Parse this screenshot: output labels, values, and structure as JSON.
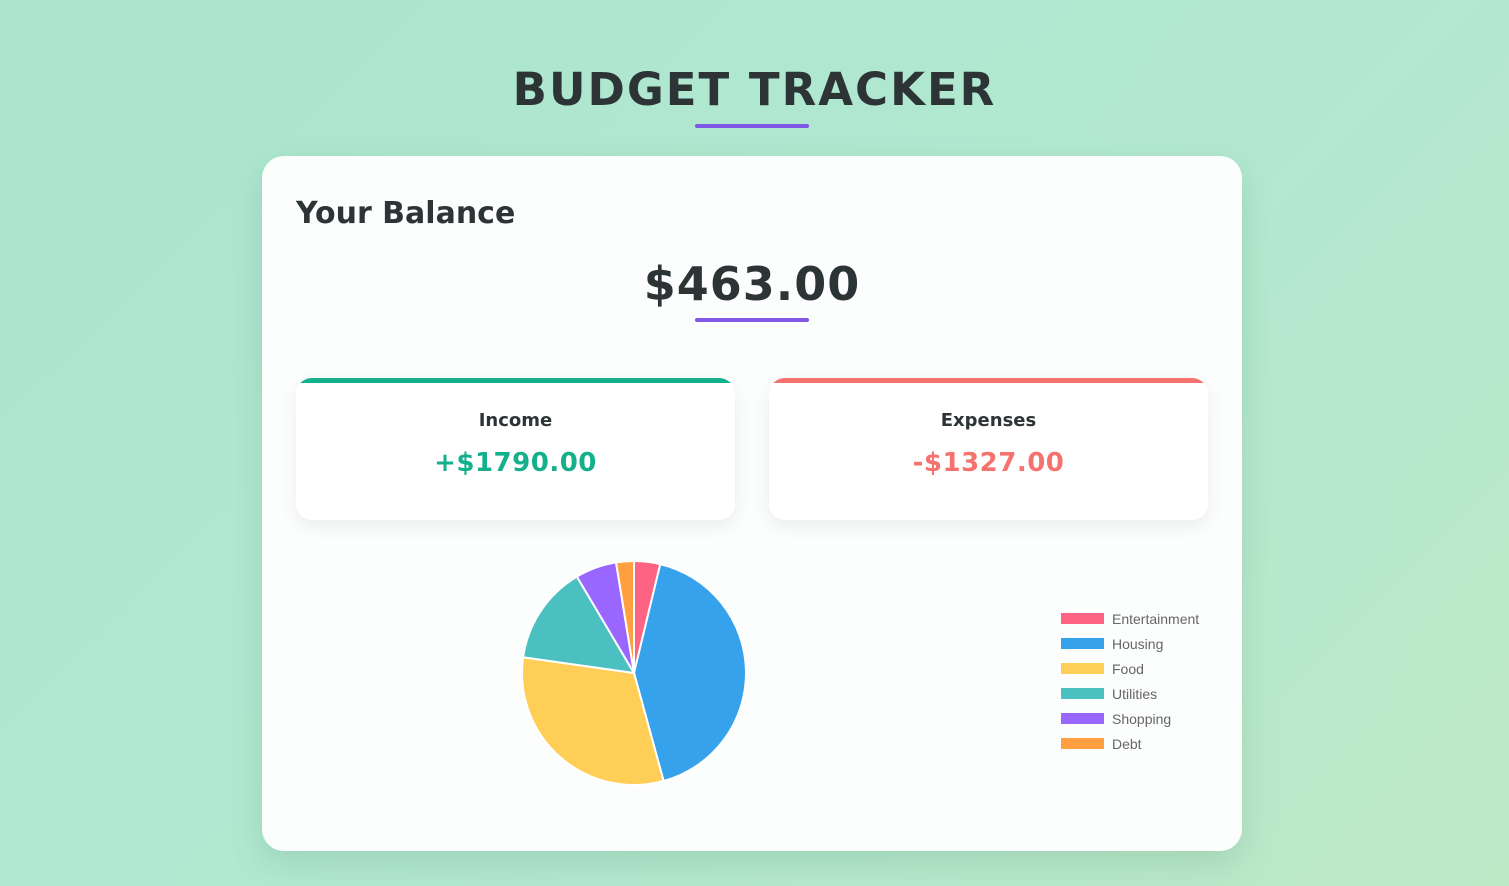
{
  "header": {
    "title": "BUDGET TRACKER"
  },
  "balance": {
    "heading": "Your Balance",
    "amount": "$463.00"
  },
  "income": {
    "label": "Income",
    "value": "+$1790.00"
  },
  "expenses": {
    "label": "Expenses",
    "value": "-$1327.00"
  },
  "colors": {
    "accent": "#7e57e6",
    "income": "#14b08c",
    "expense": "#f5736f"
  },
  "chart_data": {
    "type": "pie",
    "categories": [
      "Entertainment",
      "Housing",
      "Food",
      "Utilities",
      "Shopping",
      "Debt"
    ],
    "values": [
      50,
      557,
      418,
      189,
      79,
      34
    ],
    "colors": [
      "#ff6384",
      "#36a2eb",
      "#ffce56",
      "#4bc0c0",
      "#9966ff",
      "#ff9f40"
    ],
    "legend_position": "right"
  }
}
